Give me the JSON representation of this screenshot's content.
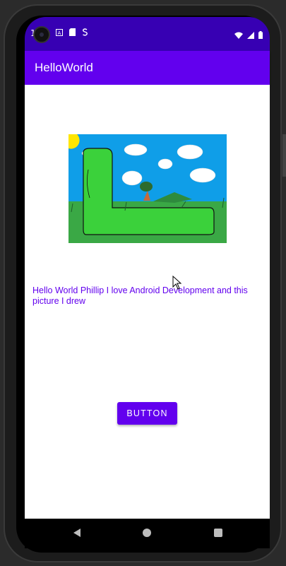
{
  "status_bar": {
    "time": "1:14",
    "icons": [
      "camera-icon",
      "a-box-icon",
      "sd-card-icon",
      "s-icon"
    ],
    "right_icons": [
      "wifi-icon",
      "signal-icon",
      "battery-icon"
    ]
  },
  "app_bar": {
    "title": "HelloWorld",
    "color": "#6200ee"
  },
  "main": {
    "message": "Hello World Phillip I love Android Development and this picture I drew",
    "button_label": "BUTTON",
    "accent": "#6200ee"
  },
  "nav_bar": {
    "icons": [
      "back-icon",
      "home-icon",
      "recents-icon"
    ]
  }
}
